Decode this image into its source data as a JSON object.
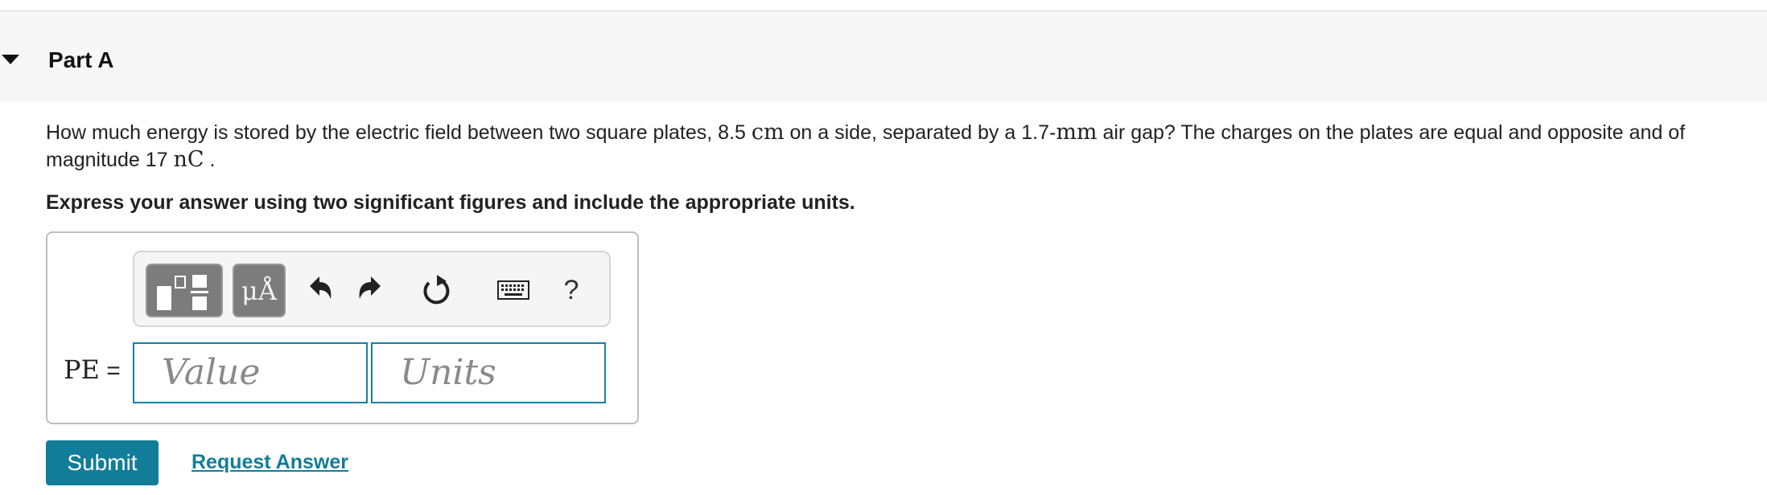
{
  "part": {
    "title": "Part A"
  },
  "question": {
    "text_1": "How much energy is stored by the electric field between two square plates, 8.5 ",
    "unit_1": "cm",
    "text_2": " on a side, separated by a 1.7-",
    "unit_2": "mm",
    "text_3": " air gap? The charges on the plates are equal and opposite and of magnitude 17 ",
    "unit_3": "nC",
    "text_4": " ."
  },
  "instruction": "Express your answer using two significant figures and include the appropriate units.",
  "answer": {
    "variable": "PE",
    "equals": " =",
    "value_placeholder": "Value",
    "units_placeholder": "Units"
  },
  "toolbar": {
    "units_glyph": "μÅ",
    "help_label": "?",
    "icons": [
      "templates-icon",
      "units-icon",
      "undo-icon",
      "redo-icon",
      "reset-icon",
      "keyboard-icon",
      "help-icon"
    ]
  },
  "actions": {
    "submit_label": "Submit",
    "request_label": "Request Answer"
  },
  "colors": {
    "accent": "#117d99",
    "input_border": "#167fa6",
    "toolbar_button": "#7c7c7c",
    "header_bg": "#f7f7f7"
  }
}
